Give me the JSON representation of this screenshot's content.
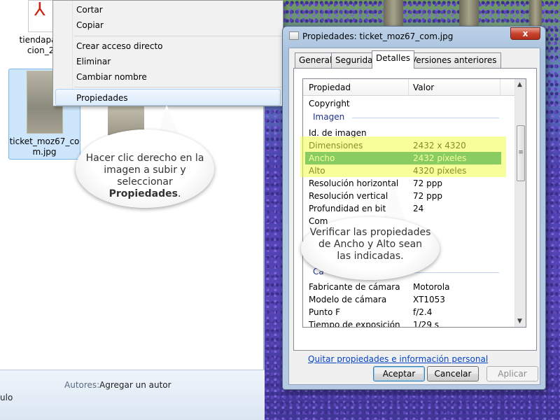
{
  "explorer": {
    "files": [
      {
        "name": "tiendapaq-\ncion_2."
      },
      {
        "name": "ticket_moz67_co\nm.jpg"
      }
    ],
    "details": {
      "authors_label": "Autores:",
      "authors_value": "Agregar un autor",
      "truncated_text": "ulo"
    }
  },
  "context_menu": {
    "items": [
      "Cortar",
      "Copiar",
      "Crear acceso directo",
      "Eliminar",
      "Cambiar nombre",
      "Propiedades"
    ],
    "highlighted": "Propiedades"
  },
  "callouts": {
    "first": {
      "line1": "Hacer clic derecho en la",
      "line2": "imagen a subir y",
      "line3_prefix": "seleccionar ",
      "line3_bold": "Propiedades",
      "line3_suffix": "."
    },
    "second": {
      "line1": "Verificar las propiedades",
      "line2": "de Ancho y Alto sean",
      "line3": "las indicadas."
    }
  },
  "dialog": {
    "title": "Propiedades: ticket_moz67_com.jpg",
    "close_glyph": "x",
    "tabs": [
      "General",
      "Seguridad",
      "Detalles",
      "Versiones anteriores"
    ],
    "active_tab": "Detalles",
    "columns": {
      "property": "Propiedad",
      "value": "Valor"
    },
    "rows": [
      {
        "k": "Copyright",
        "v": ""
      },
      {
        "k": "Id. de imagen",
        "v": ""
      },
      {
        "k": "Dimensiones",
        "v": "2432 x 4320"
      },
      {
        "k": "Ancho",
        "v": "2432 píxeles"
      },
      {
        "k": "Alto",
        "v": "4320 píxeles"
      },
      {
        "k": "Resolución horizontal",
        "v": "72 ppp"
      },
      {
        "k": "Resolución vertical",
        "v": "72 ppp"
      },
      {
        "k": "Profundidad en bit",
        "v": "24"
      },
      {
        "k": "Com",
        "v": ""
      },
      {
        "k": "Fabricante de cámara",
        "v": "Motorola"
      },
      {
        "k": "Modelo de cámara",
        "v": "XT1053"
      },
      {
        "k": "Punto F",
        "v": "f/2.4"
      },
      {
        "k": "Tiempo de exposición",
        "v": "1/29 s"
      }
    ],
    "groups": {
      "image": "Imagen",
      "camera": "Cá"
    },
    "selected_row": "Ancho",
    "remove_link": "Quitar propiedades e información personal",
    "buttons": {
      "ok": "Aceptar",
      "cancel": "Cancelar",
      "apply": "Aplicar"
    },
    "scroll": {
      "up": "▲",
      "down": "▼",
      "grip": "≡"
    }
  },
  "colors": {
    "selection": "#0f8f86",
    "highlight": "#eeff46",
    "link": "#0645c8",
    "close": "#c74530"
  }
}
